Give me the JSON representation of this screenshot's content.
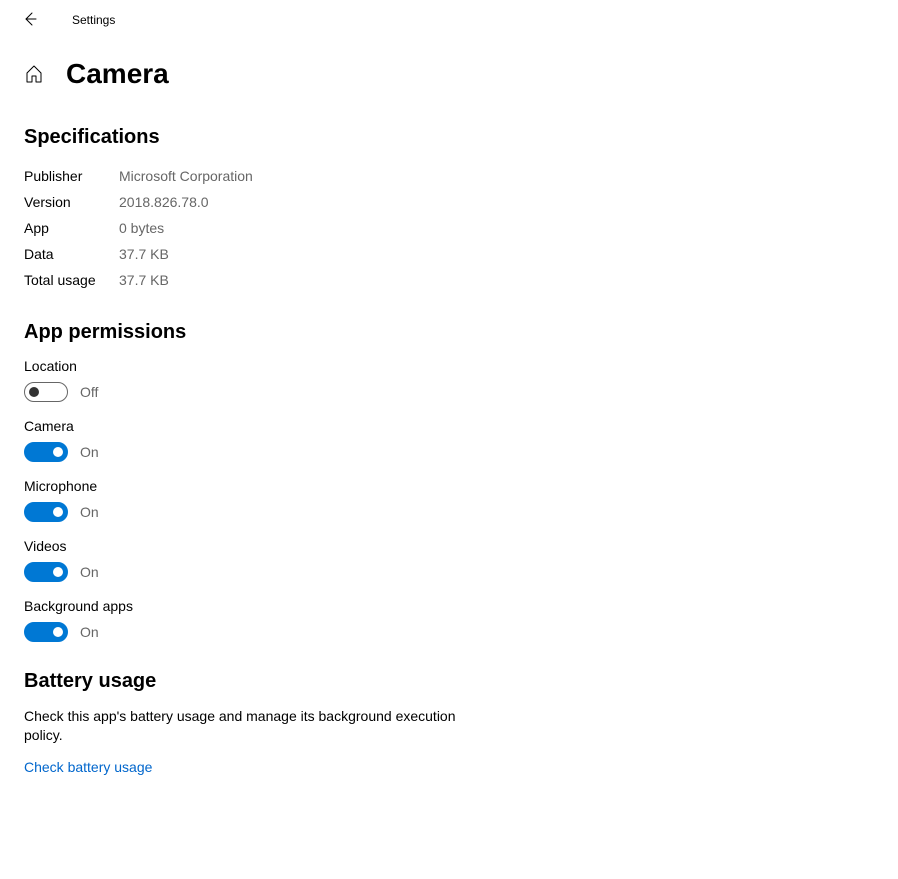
{
  "header": {
    "app_title": "Settings"
  },
  "page": {
    "title": "Camera"
  },
  "specifications": {
    "heading": "Specifications",
    "rows": [
      {
        "label": "Publisher",
        "value": "Microsoft Corporation"
      },
      {
        "label": "Version",
        "value": "2018.826.78.0"
      },
      {
        "label": "App",
        "value": "0 bytes"
      },
      {
        "label": "Data",
        "value": "37.7 KB"
      },
      {
        "label": "Total usage",
        "value": "37.7 KB"
      }
    ]
  },
  "permissions": {
    "heading": "App permissions",
    "items": [
      {
        "label": "Location",
        "state": "Off",
        "on": false
      },
      {
        "label": "Camera",
        "state": "On",
        "on": true
      },
      {
        "label": "Microphone",
        "state": "On",
        "on": true
      },
      {
        "label": "Videos",
        "state": "On",
        "on": true
      },
      {
        "label": "Background apps",
        "state": "On",
        "on": true
      }
    ]
  },
  "battery": {
    "heading": "Battery usage",
    "description": "Check this app's battery usage and manage its background execution policy.",
    "link_label": "Check battery usage"
  }
}
